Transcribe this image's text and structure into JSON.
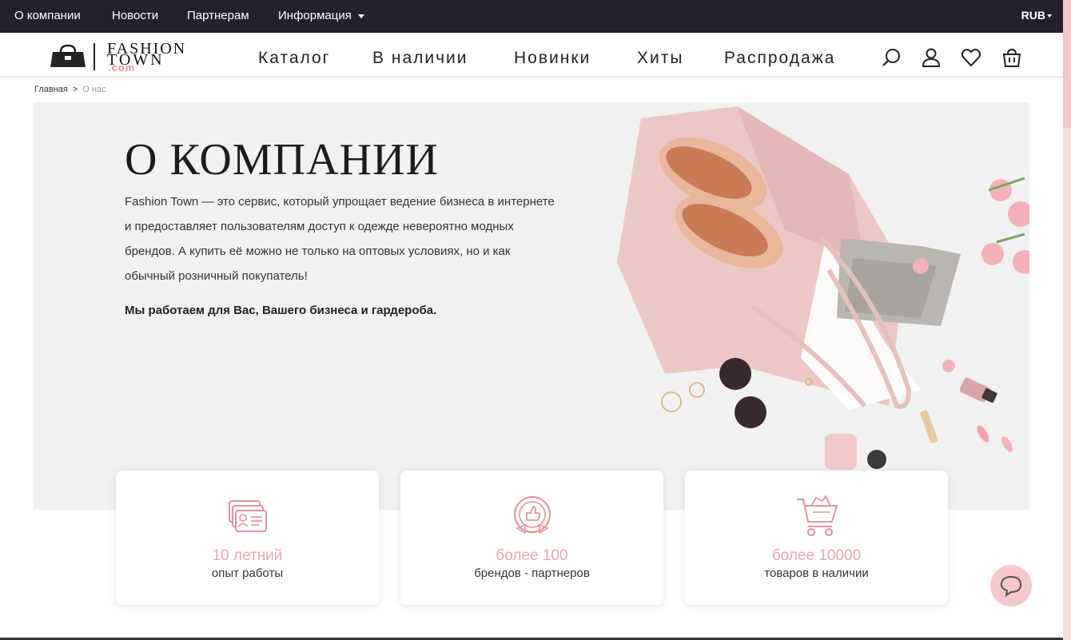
{
  "topbar": {
    "links": [
      "О компании",
      "Новости",
      "Партнерам",
      "Информация"
    ],
    "currency": "RUB"
  },
  "logo": {
    "line1": "FASHION",
    "line2": "TOWN",
    "line3": ".com"
  },
  "nav": [
    "Каталог",
    "В наличии",
    "Новинки",
    "Хиты",
    "Распродажа"
  ],
  "header_icons": [
    "search-icon",
    "user-icon",
    "heart-icon",
    "cart-icon"
  ],
  "breadcrumb": {
    "home": "Главная",
    "separator": ">",
    "current": "О нас"
  },
  "hero": {
    "title": "О КОМПАНИИ",
    "text": "Fashion Town — это сервис, который упрощает ведение бизнеса в интернете и предоставляет пользователям доступ к одежде невероятно модных брендов. А купить её можно не только на оптовых условиях, но и как обычный розничный покупатель!",
    "bold": "Мы работаем для Вас, Вашего бизнеса и гардероба."
  },
  "stats": [
    {
      "number": "10 летний",
      "label": "опыт работы",
      "icon": "id-cards-icon"
    },
    {
      "number": "более 100",
      "label": "брендов - партнеров",
      "icon": "thumbs-up-badge-icon"
    },
    {
      "number": "более 10000",
      "label": "товаров в наличии",
      "icon": "shopping-cart-icon"
    }
  ],
  "colors": {
    "topbar": "#23222c",
    "accent": "#e8a6b0",
    "hero_bg": "#f1f1f1"
  }
}
